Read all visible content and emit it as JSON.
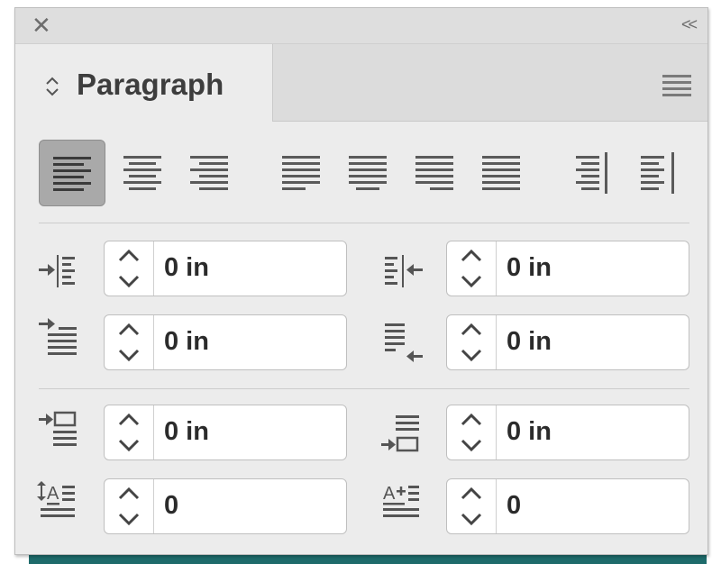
{
  "panel": {
    "title": "Paragraph",
    "close_symbol": "✕",
    "collapse_symbol": "<<",
    "menu_icon": "hamburger-menu-icon"
  },
  "alignment": {
    "buttons": [
      {
        "name": "align-left",
        "selected": true
      },
      {
        "name": "align-center",
        "selected": false
      },
      {
        "name": "align-right",
        "selected": false
      },
      {
        "name": "justify-last-left",
        "selected": false
      },
      {
        "name": "justify-last-center",
        "selected": false
      },
      {
        "name": "justify-last-right",
        "selected": false
      },
      {
        "name": "justify-all",
        "selected": false
      },
      {
        "name": "align-towards-spine",
        "selected": false
      },
      {
        "name": "align-away-from-spine",
        "selected": false
      }
    ]
  },
  "fields": {
    "left_indent": "0 in",
    "right_indent": "0 in",
    "first_line_indent": "0 in",
    "last_line_indent": "0 in",
    "space_before": "0 in",
    "space_after": "0 in",
    "drop_cap_lines": "0",
    "drop_cap_chars": "0"
  },
  "colors": {
    "panel_bg": "#ececec",
    "selected_btn": "#a9a9a9",
    "accent_bar": "#1e6b6b"
  }
}
